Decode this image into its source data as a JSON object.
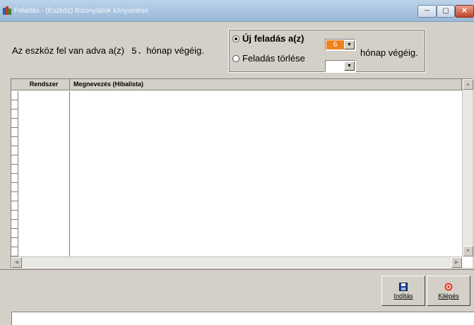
{
  "window": {
    "title": "Feladás - (Eszköz) Bizonylatok könyvelése",
    "minimize_label": "─",
    "maximize_label": "▢",
    "close_label": "✕"
  },
  "status": {
    "prefix": "Az eszköz fel van adva a(z)",
    "month_number": "5.",
    "suffix": "hónap végéig."
  },
  "posting_options": {
    "new_posting_label": "Új feladás a(z)",
    "new_posting_selected": true,
    "new_posting_month": "6",
    "delete_posting_label": "Feladás törlése",
    "delete_posting_selected": false,
    "delete_posting_month": "",
    "period_suffix": "hónap végéig."
  },
  "grid": {
    "columns": [
      "Rendszer",
      "Megnevezés (Hibalista)"
    ],
    "rows": []
  },
  "actions": {
    "start_label": "Indítás",
    "exit_label": "Kilépés"
  },
  "icons": {
    "app": "app-books-icon",
    "start": "floppy-disk-icon",
    "exit": "stop-icon"
  },
  "colors": {
    "title_gradient_top": "#bcd4ea",
    "selected_month_bg": "#f0821e",
    "exit_icon": "#e0452a"
  },
  "status_bar_text": ""
}
